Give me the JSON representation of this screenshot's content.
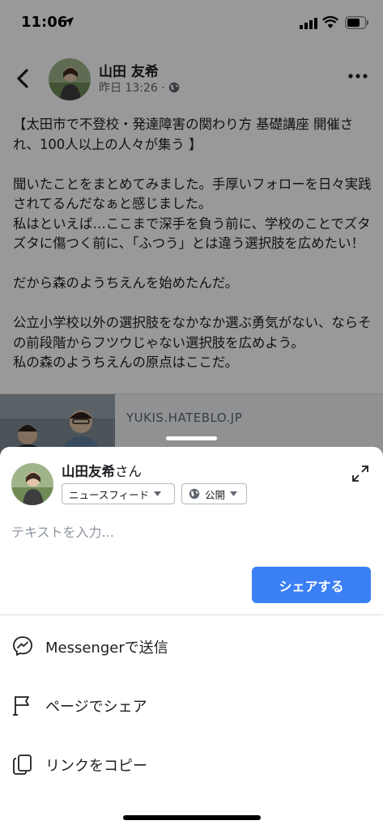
{
  "status_bar": {
    "time": "11:06"
  },
  "post": {
    "author": "山田 友希",
    "meta_time": "昨日 13:26 ·",
    "body": "【太田市で不登校・発達障害の関わり方 基礎講座 開催され、100人以上の人々が集う 】\n\n聞いたことをまとめてみました。手厚いフォローを日々実践されてるんだなぁと感じました。\n私はといえば…ここまで深手を負う前に、学校のことでズタズタに傷つく前に、「ふつう」とは違う選択肢を広めたい！\n\nだから森のようちえんを始めたんだ。\n\n公立小学校以外の選択肢をなかなか選ぶ勇気がない、ならその前段階からフツウじゃない選択肢を広めよう。\n私の森のようちえんの原点はここだ。",
    "link_domain": "YUKIS.HATEBLO.JP"
  },
  "share_sheet": {
    "user_name": "山田友希",
    "user_suffix": "さん",
    "audience_feed": "ニュースフィード",
    "audience_privacy": "公開",
    "input_placeholder": "テキストを入力...",
    "share_button": "シェアする",
    "options": [
      {
        "icon": "messenger-icon",
        "label": "Messengerで送信"
      },
      {
        "icon": "flag-icon",
        "label": "ページでシェア"
      },
      {
        "icon": "copy-icon",
        "label": "リンクをコピー"
      }
    ]
  },
  "colors": {
    "primary": "#3b7ff5",
    "text": "#1c1e21",
    "secondary_text": "#606770",
    "overlay": "rgba(0,0,0,0.4)"
  }
}
